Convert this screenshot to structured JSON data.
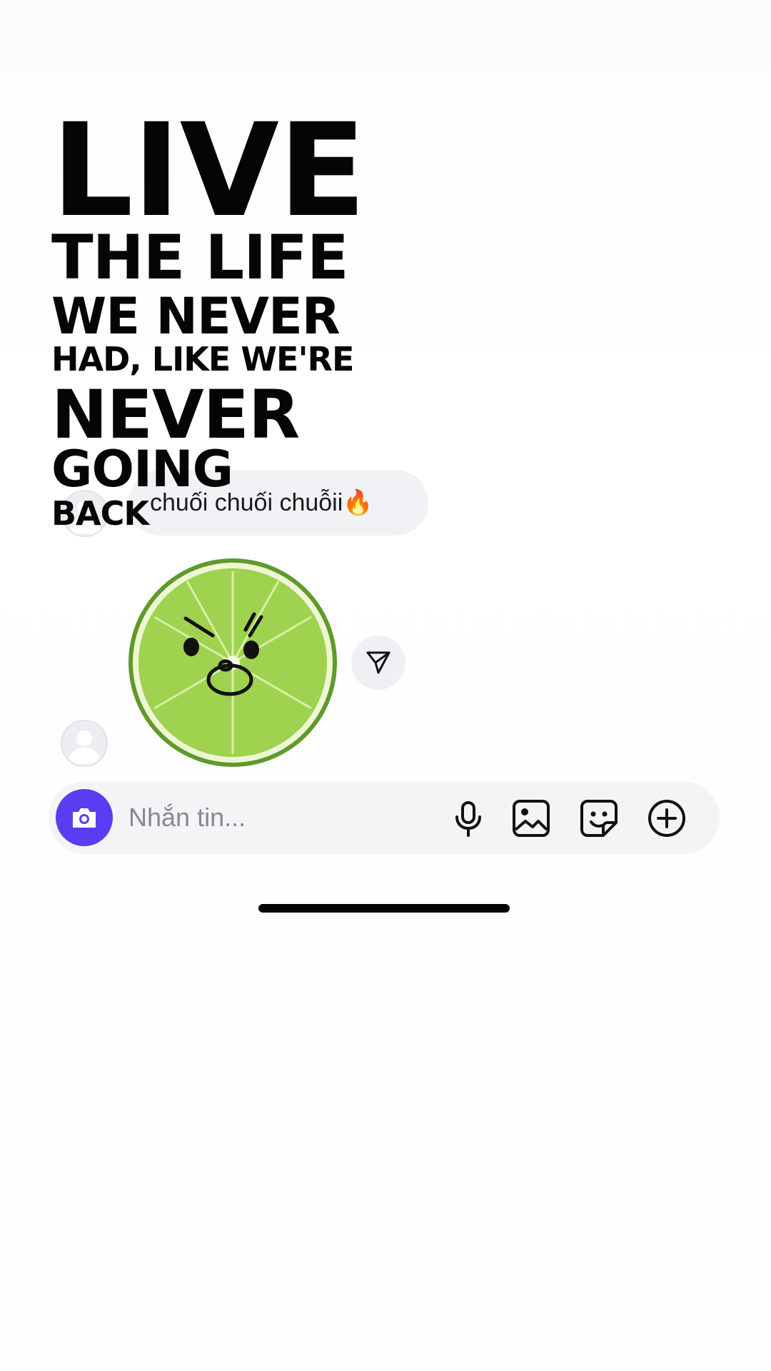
{
  "overlay": {
    "lines": [
      "LIVE",
      "THE LIFE",
      "WE NEVER",
      "HAD, LIKE WE'RE",
      "NEVER",
      "GOING",
      "BACK"
    ]
  },
  "messages": {
    "text_bubble": "chuối chuối chuỗii🔥",
    "sticker": "angry-lime-sticker"
  },
  "composer": {
    "placeholder": "Nhắn tin..."
  },
  "icons": {
    "camera": "camera-icon",
    "mic": "microphone-icon",
    "photo": "image-icon",
    "sticker": "sticker-icon",
    "plus": "plus-circle-icon",
    "share": "send-icon"
  },
  "colors": {
    "accent": "#5a3df0",
    "bubble": "#f1f2f5",
    "composer": "#f3f4f6",
    "lime": "#9bd24a"
  }
}
